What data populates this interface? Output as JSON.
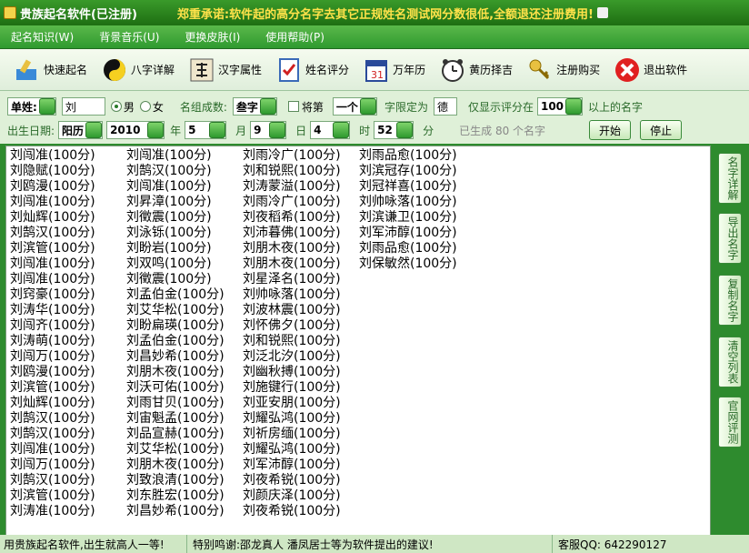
{
  "window": {
    "title": "贵族起名软件(已注册)",
    "promise": "郑重承诺:软件起的高分名字去其它正规姓名测试网分数很低,全额退还注册费用!"
  },
  "menu": [
    "起名知识(W)",
    "背景音乐(U)",
    "更换皮肤(I)",
    "使用帮助(P)"
  ],
  "toolbar": [
    {
      "label": "快速起名",
      "icon": "quick-name-icon"
    },
    {
      "label": "八字详解",
      "icon": "yin-yang-icon"
    },
    {
      "label": "汉字属性",
      "icon": "calligraphy-icon"
    },
    {
      "label": "姓名评分",
      "icon": "checklist-icon"
    },
    {
      "label": "万年历",
      "icon": "calendar-icon"
    },
    {
      "label": "黄历择吉",
      "icon": "alarm-clock-icon"
    },
    {
      "label": "注册购买",
      "icon": "keys-icon"
    },
    {
      "label": "退出软件",
      "icon": "close-icon"
    }
  ],
  "options": {
    "surname_type": "单姓:",
    "surname": "刘",
    "gender_male": "男",
    "gender_female": "女",
    "composition_label": "名组成数:",
    "composition_value": "叁字",
    "fixed_label": "将第",
    "fixed_pos": "一个",
    "limit_label": "字限定为",
    "limit_value": "德",
    "show_label": "仅显示评分在",
    "show_value": "100",
    "above_label": "以上的名字",
    "birth_label": "出生日期:",
    "calendar": "阳历",
    "year": "2010",
    "year_label": "年",
    "month": "5",
    "month_label": "月",
    "day": "9",
    "day_label": "日",
    "hour": "4",
    "hour_label": "时",
    "minute": "52",
    "minute_label": "分",
    "generated": "已生成 80 个名字",
    "start_button": "开始",
    "stop_button": "停止"
  },
  "names": {
    "col1": [
      "刘闯准(100分)",
      "刘隐赋(100分)",
      "刘鸥漫(100分)",
      "刘闯准(100分)",
      "刘灿辉(100分)",
      "刘鹄汉(100分)",
      "刘滨管(100分)",
      "刘闯准(100分)",
      "刘闯准(100分)",
      "刘窍豪(100分)",
      "刘涛华(100分)",
      "刘闯齐(100分)",
      "刘涛萌(100分)",
      "刘闯万(100分)",
      "刘鸥漫(100分)",
      "刘滨管(100分)",
      "刘灿辉(100分)",
      "刘鹄汉(100分)",
      "刘鹄汉(100分)",
      "刘闯准(100分)",
      "刘闯万(100分)",
      "刘鹄汉(100分)",
      "刘滨管(100分)",
      "刘涛准(100分)"
    ],
    "col2": [
      "刘闯准(100分)",
      "刘鹄汉(100分)",
      "刘闯准(100分)",
      "刘昇漳(100分)",
      "刘徵震(100分)",
      "刘泳铄(100分)",
      "刘盼岩(100分)",
      "刘双鸣(100分)",
      "刘徵震(100分)",
      "刘孟伯金(100分)",
      "刘艾华松(100分)",
      "刘盼扁瑛(100分)",
      "刘孟伯金(100分)",
      "刘昌妙希(100分)",
      "刘朋木夜(100分)",
      "刘沃可佑(100分)",
      "刘雨甘贝(100分)",
      "刘宙魁孟(100分)",
      "刘品宣赫(100分)",
      "刘艾华松(100分)",
      "刘朋木夜(100分)",
      "刘致浪清(100分)",
      "刘东胜宏(100分)",
      "刘昌妙希(100分)"
    ],
    "col3": [
      "刘雨冷广(100分)",
      "刘和锐熙(100分)",
      "刘涛蒙溢(100分)",
      "刘雨冷广(100分)",
      "刘夜稻希(100分)",
      "刘沛暮佛(100分)",
      "刘朋木夜(100分)",
      "刘朋木夜(100分)",
      "刘星泽名(100分)",
      "刘帅咏落(100分)",
      "刘波林震(100分)",
      "刘怀佛夕(100分)",
      "刘和锐熙(100分)",
      "刘泛北汐(100分)",
      "刘幽秋搏(100分)",
      "刘施键行(100分)",
      "刘亚安朋(100分)",
      "刘耀弘鸿(100分)",
      "刘祈房缅(100分)",
      "刘耀弘鸿(100分)",
      "刘军沛醇(100分)",
      "刘夜希锐(100分)",
      "刘颜庆泽(100分)",
      "刘夜希锐(100分)"
    ],
    "col4": [
      "刘雨品愈(100分)",
      "刘滨冠存(100分)",
      "刘冠祥喜(100分)",
      "刘帅咏落(100分)",
      "刘滨谦卫(100分)",
      "刘军沛醇(100分)",
      "刘雨品愈(100分)",
      "刘保敏然(100分)"
    ]
  },
  "side_buttons": [
    "名字详解",
    "导出名字",
    "复制名字",
    "清空列表",
    "官网评测"
  ],
  "status": {
    "seg1": "用贵族起名软件,出生就高人一等!",
    "seg2": "特别鸣谢:邵龙真人 潘凤居士等为软件提出的建议!",
    "seg3": "客服QQ: 642290127"
  },
  "colors": {
    "title_bg": "#2a8a1e",
    "menu_bg": "#3aa43a",
    "promise_text": "#ffe24a",
    "label_text": "#2a6a2a"
  }
}
